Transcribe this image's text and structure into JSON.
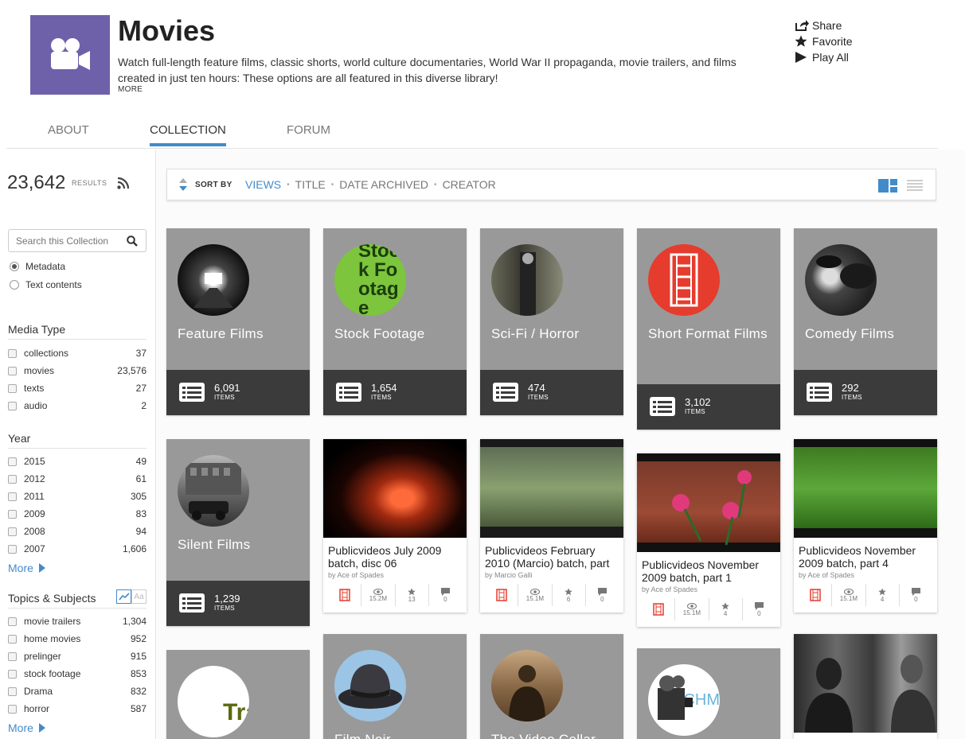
{
  "header": {
    "title": "Movies",
    "description": "Watch full-length feature films, classic shorts, world culture documentaries, World War II propaganda, movie trailers, and films created in just ten hours: These options are all featured in this diverse library!",
    "more_label": "MORE",
    "logo_color": "#6e61a9",
    "actions": [
      {
        "label": "Share",
        "icon": "share-icon"
      },
      {
        "label": "Favorite",
        "icon": "star-icon"
      },
      {
        "label": "Play All",
        "icon": "play-icon"
      }
    ]
  },
  "tabs": [
    {
      "label": "ABOUT",
      "active": false
    },
    {
      "label": "COLLECTION",
      "active": true
    },
    {
      "label": "FORUM",
      "active": false
    }
  ],
  "sidebar": {
    "results_count": "23,642",
    "results_label": "RESULTS",
    "search_placeholder": "Search this Collection",
    "search_scope": [
      {
        "label": "Metadata",
        "selected": true
      },
      {
        "label": "Text contents",
        "selected": false
      }
    ],
    "media_type": {
      "title": "Media Type",
      "items": [
        {
          "label": "collections",
          "count": "37"
        },
        {
          "label": "movies",
          "count": "23,576"
        },
        {
          "label": "texts",
          "count": "27"
        },
        {
          "label": "audio",
          "count": "2"
        }
      ]
    },
    "year": {
      "title": "Year",
      "items": [
        {
          "label": "2015",
          "count": "49"
        },
        {
          "label": "2012",
          "count": "61"
        },
        {
          "label": "2011",
          "count": "305"
        },
        {
          "label": "2009",
          "count": "83"
        },
        {
          "label": "2008",
          "count": "94"
        },
        {
          "label": "2007",
          "count": "1,606"
        }
      ],
      "more_label": "More"
    },
    "topics": {
      "title": "Topics & Subjects",
      "toggle_text": "Aa",
      "items": [
        {
          "label": "movie trailers",
          "count": "1,304"
        },
        {
          "label": "home movies",
          "count": "952"
        },
        {
          "label": "prelinger",
          "count": "915"
        },
        {
          "label": "stock footage",
          "count": "853"
        },
        {
          "label": "Drama",
          "count": "832"
        },
        {
          "label": "horror",
          "count": "587"
        }
      ],
      "more_label": "More"
    }
  },
  "sortbar": {
    "label": "SORT BY",
    "options": [
      {
        "label": "VIEWS",
        "active": true
      },
      {
        "label": "TITLE",
        "active": false
      },
      {
        "label": "DATE ARCHIVED",
        "active": false
      },
      {
        "label": "CREATOR",
        "active": false
      }
    ],
    "accent_color": "#428bca"
  },
  "collections": [
    {
      "title": "Feature Films",
      "count": "6,091",
      "items_label": "ITEMS"
    },
    {
      "title": "Stock Footage",
      "count": "1,654",
      "items_label": "ITEMS",
      "thumb_text": "Stock Footage"
    },
    {
      "title": "Sci-Fi / Horror",
      "count": "474",
      "items_label": "ITEMS"
    },
    {
      "title": "Short Format Films",
      "count": "3,102",
      "items_label": "ITEMS"
    },
    {
      "title": "Comedy Films",
      "count": "292",
      "items_label": "ITEMS"
    },
    {
      "title": "Silent Films",
      "count": "1,239",
      "items_label": "ITEMS"
    },
    {
      "title": "",
      "thumb_text": "Tra"
    },
    {
      "title": "Film Noir"
    },
    {
      "title": "The Video Cellar"
    },
    {
      "title": "",
      "thumb_text": "CHM"
    }
  ],
  "items": [
    {
      "title": "Publicvideos July 2009 batch, disc 06",
      "by": "by Ace of Spades",
      "views": "15.2M",
      "favs": "13",
      "reviews": "0"
    },
    {
      "title": "Publicvideos February 2010 (Marcio) batch, part",
      "by": "by Marcio Galli",
      "views": "15.1M",
      "favs": "6",
      "reviews": "0"
    },
    {
      "title": "Publicvideos November 2009 batch, part 1",
      "by": "by Ace of Spades",
      "views": "15.1M",
      "favs": "4",
      "reviews": "0"
    },
    {
      "title": "Publicvideos November 2009 batch, part 4",
      "by": "by Ace of Spades",
      "views": "15.1M",
      "favs": "4",
      "reviews": "0"
    }
  ]
}
